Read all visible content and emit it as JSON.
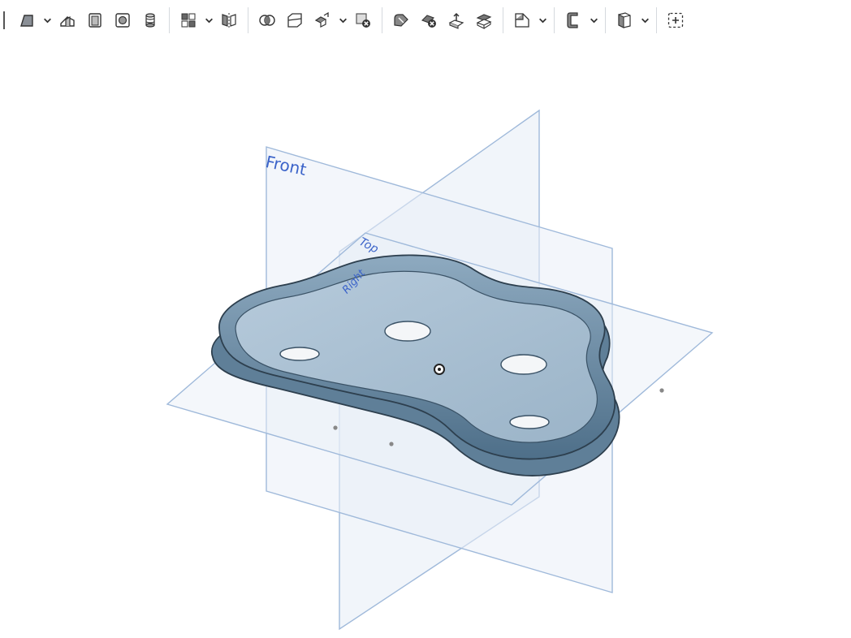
{
  "toolbar": {
    "tools": [
      {
        "name": "draft-icon",
        "dropdown": true
      },
      {
        "name": "rib-icon",
        "dropdown": false
      },
      {
        "name": "shell-icon",
        "dropdown": false
      },
      {
        "name": "hole-icon",
        "dropdown": false
      },
      {
        "name": "thread-icon",
        "dropdown": false
      },
      {
        "name": "linear-pattern-icon",
        "dropdown": true
      },
      {
        "name": "mirror-icon",
        "dropdown": false
      },
      {
        "name": "boolean-icon",
        "dropdown": false
      },
      {
        "name": "split-icon",
        "dropdown": false
      },
      {
        "name": "transform-icon",
        "dropdown": true
      },
      {
        "name": "delete-part-icon",
        "dropdown": false
      },
      {
        "name": "modify-fillet-icon",
        "dropdown": false
      },
      {
        "name": "delete-face-icon",
        "dropdown": false
      },
      {
        "name": "move-face-icon",
        "dropdown": false
      },
      {
        "name": "replace-face-icon",
        "dropdown": false
      },
      {
        "name": "plane-icon",
        "dropdown": true
      },
      {
        "name": "sheet-metal-icon",
        "dropdown": true
      },
      {
        "name": "surface-icon",
        "dropdown": true
      },
      {
        "name": "add-custom-feature-icon",
        "dropdown": false
      }
    ]
  },
  "viewport": {
    "planes": {
      "front": "Front",
      "top": "Top",
      "right": "Right"
    }
  },
  "colors": {
    "plane_fill": "#e9eff8",
    "plane_edge": "#9fb9da",
    "plane_label": "#3b63c9",
    "part_body": "#6d8fa9",
    "part_floor": "#a9c0d2",
    "part_edge": "#2d3f4e"
  }
}
